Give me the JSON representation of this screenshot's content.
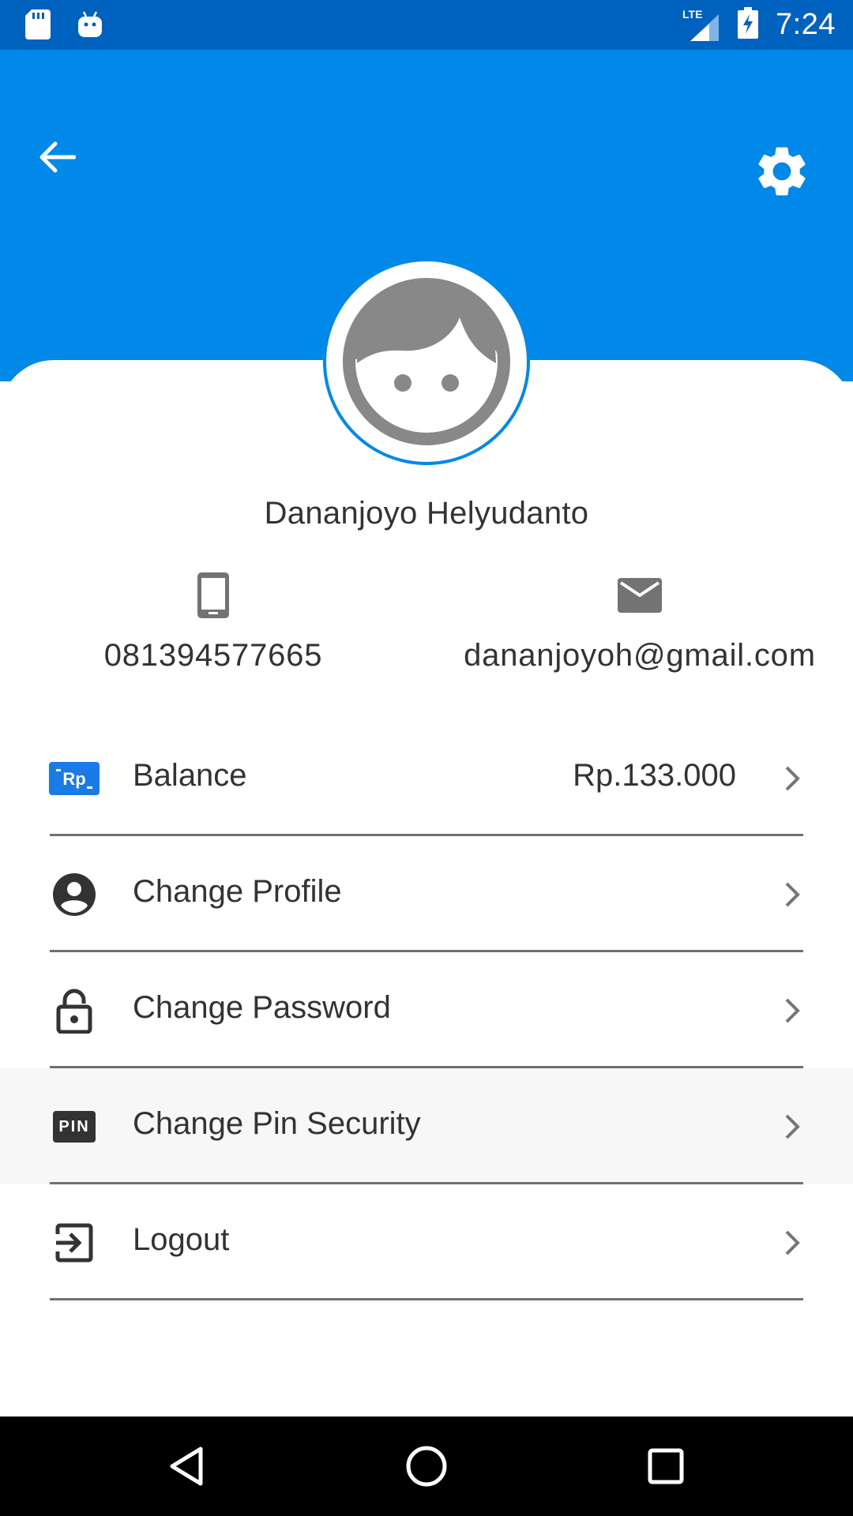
{
  "status_bar": {
    "time": "7:24",
    "network": "LTE",
    "icons": [
      "sd-card-icon",
      "android-icon",
      "lte-signal-icon",
      "battery-charging-icon"
    ]
  },
  "header": {
    "back_icon": "arrow-left-icon",
    "settings_icon": "gear-icon",
    "color": "#0089e8"
  },
  "profile": {
    "name": "Dananjoyo Helyudanto",
    "phone": "081394577665",
    "email": "dananjoyoh@gmail.com",
    "avatar_icon": "face-avatar-icon"
  },
  "menu": {
    "items": [
      {
        "label": "Balance",
        "value": "Rp.133.000",
        "icon": "rupiah-icon"
      },
      {
        "label": "Change Profile",
        "icon": "account-circle-icon"
      },
      {
        "label": "Change Password",
        "icon": "lock-open-icon"
      },
      {
        "label": "Change Pin Security",
        "icon": "pin-icon",
        "icon_text": "PIN"
      },
      {
        "label": "Logout",
        "icon": "logout-icon"
      }
    ]
  },
  "nav_bar": {
    "icons": [
      "back-triangle-icon",
      "home-circle-icon",
      "recents-square-icon"
    ]
  }
}
